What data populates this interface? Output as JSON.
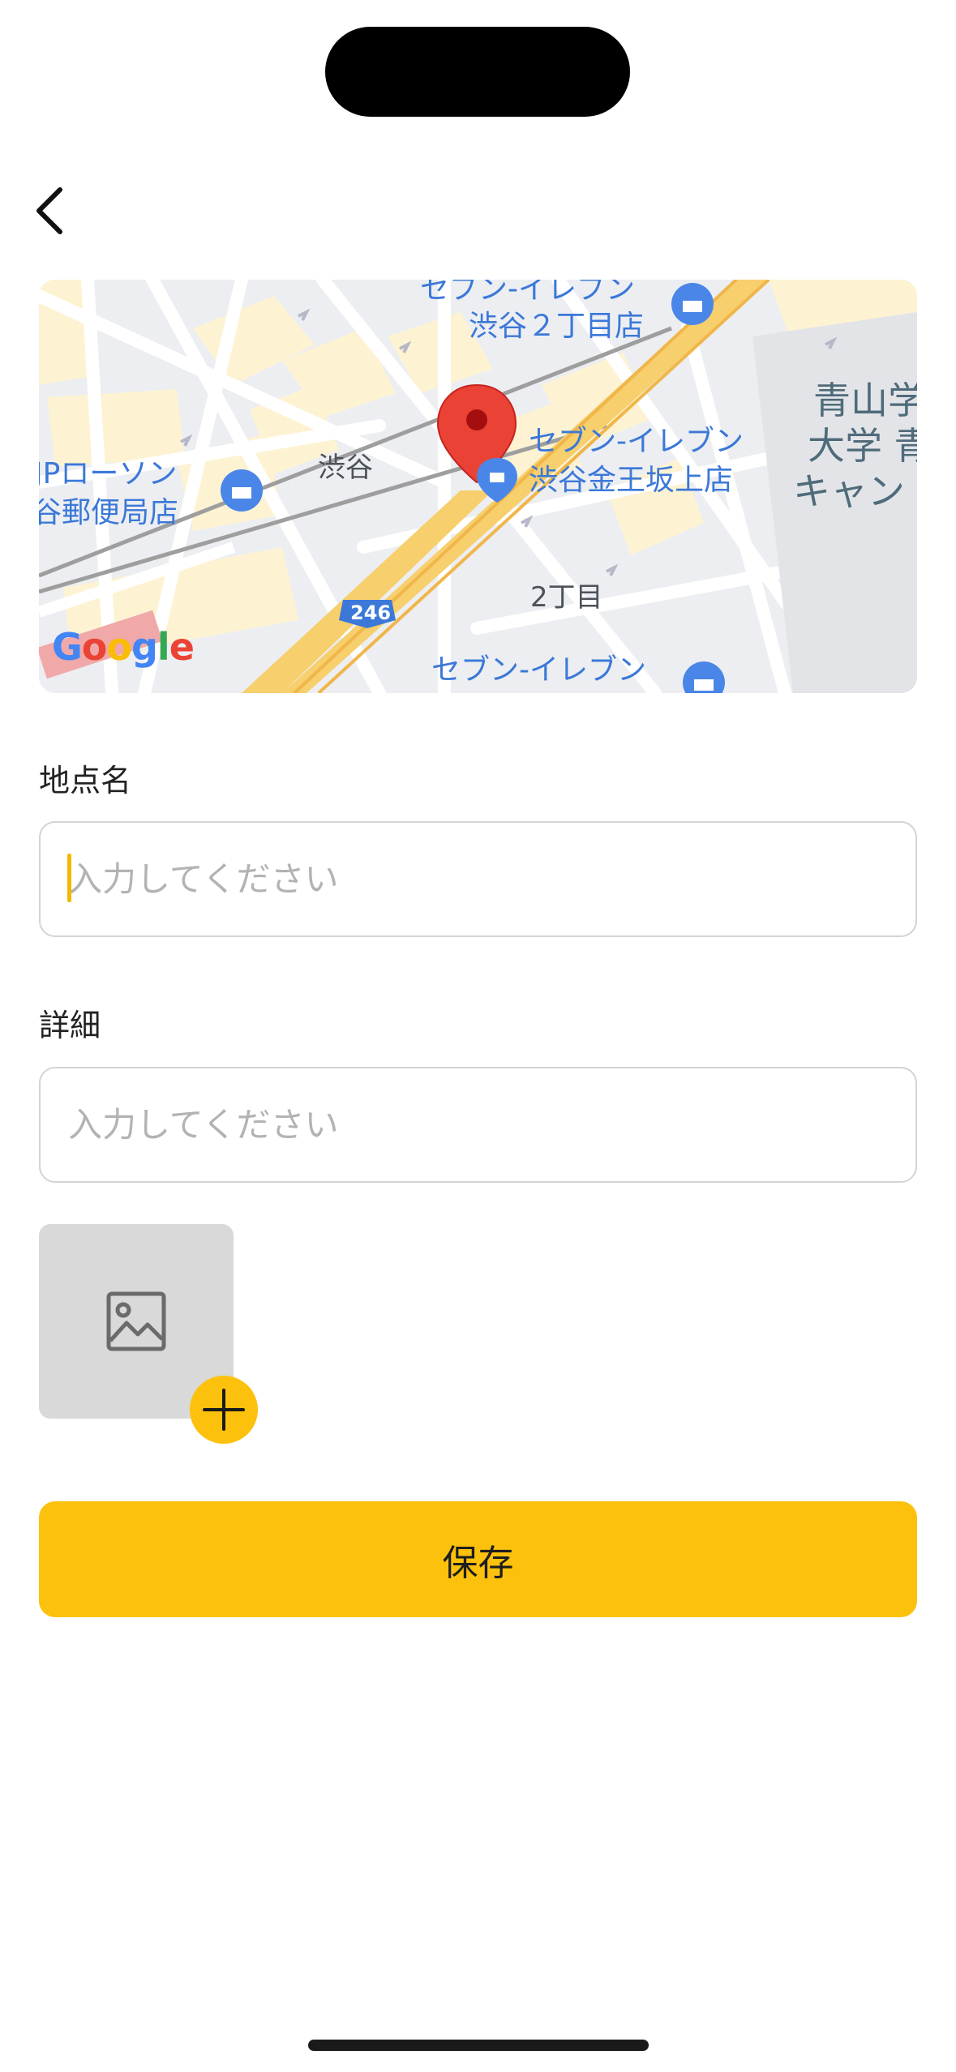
{
  "header": {
    "back_icon": "chevron-left-icon"
  },
  "map": {
    "labels": {
      "seven_1": "セブン-イレブン",
      "seven_1_sub": "渋谷２丁目店",
      "jp_lawson": "JPローソン",
      "jp_lawson_sub": "谷郵便局店",
      "shibuya": "渋谷",
      "seven_2": "セブン-イレブン",
      "seven_2_sub": "渋谷金王坂上店",
      "aoyama_1": "青山学",
      "aoyama_2": "大学 青",
      "aoyama_3": "キャン",
      "chome": "2丁目",
      "route": "246",
      "seven_3": "セブン-イレブン"
    },
    "google_logo": "Google",
    "pin_color": "#EA4335"
  },
  "form": {
    "place_name_label": "地点名",
    "place_name_placeholder": "入力してください",
    "place_name_value": "",
    "detail_label": "詳細",
    "detail_placeholder": "入力してください",
    "detail_value": ""
  },
  "photo": {
    "icon": "image-icon",
    "add_icon": "plus-icon"
  },
  "save_label": "保存",
  "colors": {
    "accent": "#FCC10C",
    "caret": "#F5B800"
  }
}
